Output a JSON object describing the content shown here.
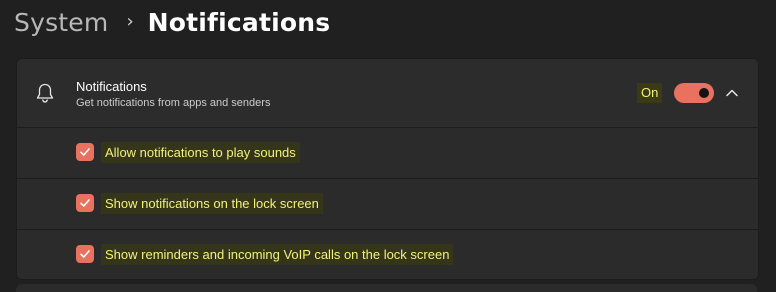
{
  "breadcrumb": {
    "parent": "System",
    "separator": "›",
    "current": "Notifications"
  },
  "notifications": {
    "title": "Notifications",
    "subtitle": "Get notifications from apps and senders",
    "state_label": "On",
    "toggle_on": true,
    "expanded": true,
    "options": [
      {
        "label": "Allow notifications to play sounds",
        "checked": true
      },
      {
        "label": "Show notifications on the lock screen",
        "checked": true
      },
      {
        "label": "Show reminders and incoming VoIP calls on the lock screen",
        "checked": true
      }
    ]
  },
  "colors": {
    "accent": "#e8725f",
    "background": "#202020",
    "card": "#2b2b2b",
    "highlight_text": "#f2f27a"
  },
  "icons": {
    "header": "bell-icon",
    "expand": "chevron-up-icon",
    "check": "checkmark-icon"
  }
}
